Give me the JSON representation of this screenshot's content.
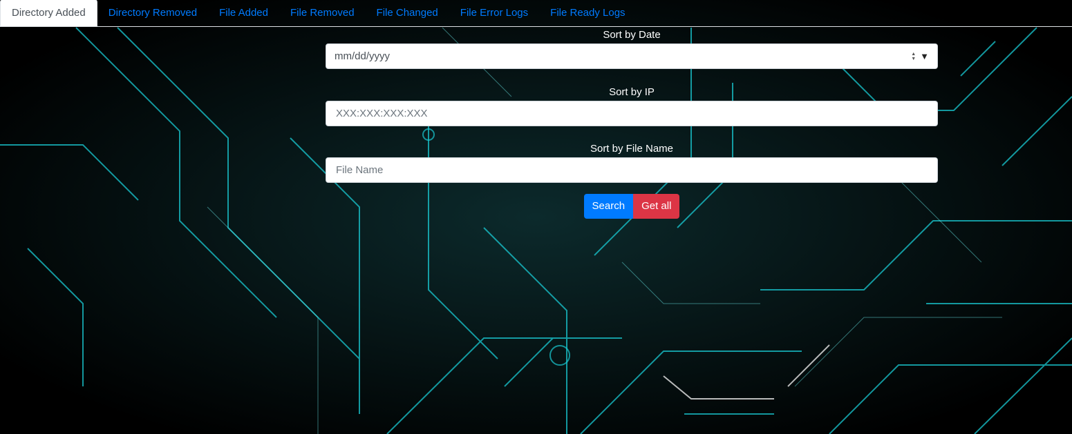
{
  "tabs": [
    {
      "label": "Directory Added",
      "active": true
    },
    {
      "label": "Directory Removed",
      "active": false
    },
    {
      "label": "File Added",
      "active": false
    },
    {
      "label": "File Removed",
      "active": false
    },
    {
      "label": "File Changed",
      "active": false
    },
    {
      "label": "File Error Logs",
      "active": false
    },
    {
      "label": "File Ready Logs",
      "active": false
    }
  ],
  "form": {
    "date_label": "Sort by Date",
    "date_value": "mm/dd/yyyy",
    "ip_label": "Sort by IP",
    "ip_placeholder": "XXX:XXX:XXX:XXX",
    "file_label": "Sort by File Name",
    "file_placeholder": "File Name",
    "search_label": "Search",
    "get_all_label": "Get all"
  },
  "colors": {
    "primary": "#007bff",
    "danger": "#dc3545",
    "circuit": "#19c9d2"
  },
  "icons": {
    "date_spinner": "spinner-icon",
    "date_dropdown": "dropdown-arrow-icon"
  }
}
